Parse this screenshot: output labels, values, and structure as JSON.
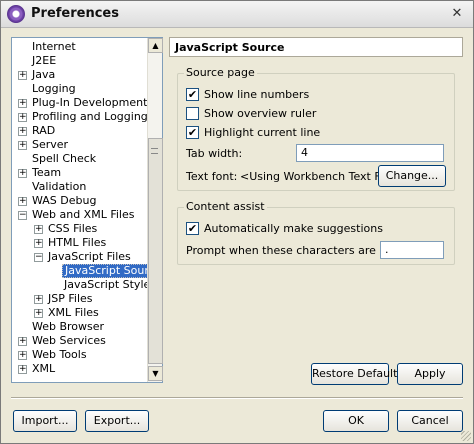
{
  "window": {
    "title": "Preferences",
    "close_glyph": "✕"
  },
  "tree": {
    "items": [
      {
        "label": "Internet",
        "level": 1,
        "expander": ""
      },
      {
        "label": "J2EE",
        "level": 1,
        "expander": ""
      },
      {
        "label": "Java",
        "level": 1,
        "expander": "+"
      },
      {
        "label": "Logging",
        "level": 1,
        "expander": ""
      },
      {
        "label": "Plug-In Development",
        "level": 1,
        "expander": "+"
      },
      {
        "label": "Profiling and Logging",
        "level": 1,
        "expander": "+"
      },
      {
        "label": "RAD",
        "level": 1,
        "expander": "+"
      },
      {
        "label": "Server",
        "level": 1,
        "expander": "+"
      },
      {
        "label": "Spell Check",
        "level": 1,
        "expander": ""
      },
      {
        "label": "Team",
        "level": 1,
        "expander": "+"
      },
      {
        "label": "Validation",
        "level": 1,
        "expander": ""
      },
      {
        "label": "WAS Debug",
        "level": 1,
        "expander": "+"
      },
      {
        "label": "Web and XML Files",
        "level": 1,
        "expander": "−"
      },
      {
        "label": "CSS Files",
        "level": 2,
        "expander": "+"
      },
      {
        "label": "HTML Files",
        "level": 2,
        "expander": "+"
      },
      {
        "label": "JavaScript Files",
        "level": 2,
        "expander": "−"
      },
      {
        "label": "JavaScript Source",
        "level": 3,
        "expander": "",
        "selected": true
      },
      {
        "label": "JavaScript Styles",
        "level": 3,
        "expander": ""
      },
      {
        "label": "JSP Files",
        "level": 2,
        "expander": "+"
      },
      {
        "label": "XML Files",
        "level": 2,
        "expander": "+"
      },
      {
        "label": "Web Browser",
        "level": 1,
        "expander": ""
      },
      {
        "label": "Web Services",
        "level": 1,
        "expander": "+"
      },
      {
        "label": "Web Tools",
        "level": 1,
        "expander": "+"
      },
      {
        "label": "XML",
        "level": 1,
        "expander": "+"
      }
    ],
    "scroll_up": "▲",
    "scroll_down": "▼"
  },
  "page": {
    "title": "JavaScript Source",
    "source_group": {
      "legend": "Source page",
      "show_line_numbers": {
        "label": "Show line numbers",
        "checked": true
      },
      "show_overview_ruler": {
        "label": "Show overview ruler",
        "checked": false
      },
      "highlight_current_line": {
        "label": "Highlight current line",
        "checked": true
      },
      "tab_width_label": "Tab width:",
      "tab_width_value": "4",
      "text_font_label": "Text font:",
      "text_font_value": "<Using Workbench Text Font>",
      "change_button": "Change..."
    },
    "assist_group": {
      "legend": "Content assist",
      "auto_suggest": {
        "label": "Automatically make suggestions",
        "checked": true
      },
      "prompt_label": "Prompt when these characters are inserted:",
      "prompt_value": "."
    },
    "restore_defaults": "Restore Defaults",
    "apply": "Apply"
  },
  "footer": {
    "import": "Import...",
    "export": "Export...",
    "ok": "OK",
    "cancel": "Cancel"
  },
  "check_glyph": "✔"
}
